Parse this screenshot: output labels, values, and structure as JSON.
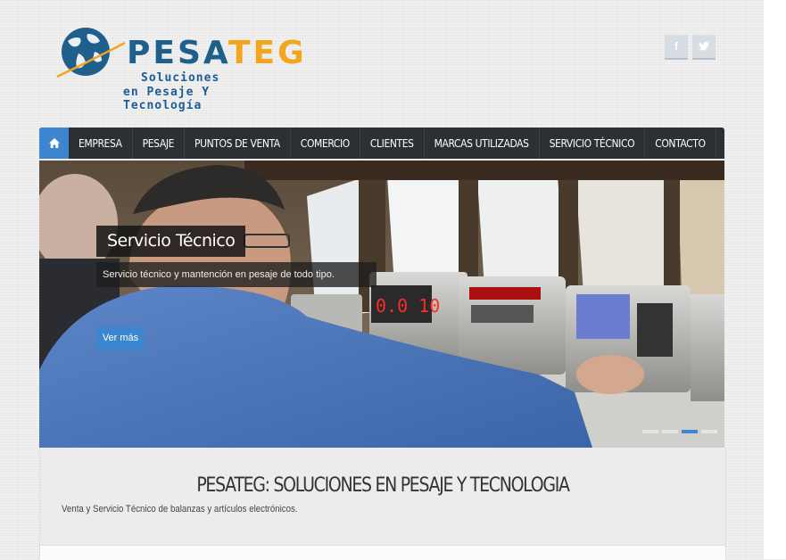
{
  "logo": {
    "brand_a": "PESA",
    "brand_b": "TEG",
    "tagline1": "Soluciones",
    "tagline2": "en Pesaje Y Tecnología"
  },
  "social": {
    "facebook": "f",
    "twitter": "t"
  },
  "nav": {
    "items": [
      "EMPRESA",
      "PESAJE",
      "PUNTOS DE VENTA",
      "COMERCIO",
      "CLIENTES",
      "MARCAS UTILIZADAS",
      "SERVICIO TÉCNICO",
      "CONTACTO"
    ]
  },
  "slider": {
    "title": "Servicio Técnico",
    "text": "Servicio técnico y mantención en pesaje de todo tipo.",
    "button": "Ver más",
    "display_value": "0.0 10",
    "slides": 4,
    "active_slide": 3
  },
  "content": {
    "heading": "PESATEG: SOLUCIONES EN PESAJE Y TECNOLOGIA",
    "subtitle": "Venta y Servicio Técnico de balanzas y artículos electrónicos."
  },
  "colors": {
    "accent": "#3d86cf",
    "nav_bg": "#2c2f33",
    "brand_blue": "#1f5f8c",
    "brand_orange": "#f3a51c"
  }
}
